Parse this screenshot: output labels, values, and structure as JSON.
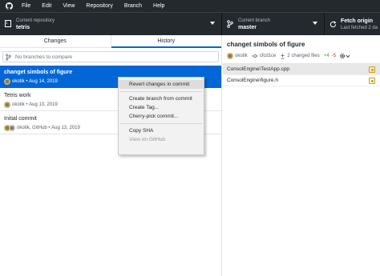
{
  "menu": {
    "items": [
      "File",
      "Edit",
      "View",
      "Repository",
      "Branch",
      "Help"
    ]
  },
  "toolbar": {
    "repo_label": "Current repository",
    "repo_value": "tetris",
    "branch_label": "Current branch",
    "branch_value": "master",
    "fetch_title": "Fetch origin",
    "fetch_sub": "Last fetched 2 da"
  },
  "tabs": {
    "changes": "Changes",
    "history": "History"
  },
  "compare": {
    "placeholder": "No branches to compare"
  },
  "commits": [
    {
      "title": "changet simbols of figure",
      "author": "okotik",
      "date": "Aug 14, 2019"
    },
    {
      "title": "Tetris work",
      "author": "okotik",
      "date": "Aug 13, 2019"
    },
    {
      "title": "Initial commit",
      "author": "okotik, GitHub",
      "date": "Aug 13, 2019"
    }
  ],
  "context_menu": {
    "items": [
      "Revert changes in commit",
      "Create branch from commit",
      "Create Tag...",
      "Cherry-pick commit...",
      "Copy SHA",
      "View on GitHub"
    ]
  },
  "detail": {
    "title": "changet simbols of figure",
    "author": "okotik",
    "sha": "cfcd1ce",
    "files_changed": "2 changed files",
    "additions": "+4",
    "deletions": "-5",
    "files": [
      "ConsolEngine\\TestApp.cpp",
      "ConsolEngine\\figure.h"
    ]
  },
  "colors": {
    "toolbar_bg": "#24292e",
    "selected_bg": "#0366d6",
    "additions": "#28a745",
    "deletions": "#cb2431",
    "modified": "#d29d04"
  }
}
